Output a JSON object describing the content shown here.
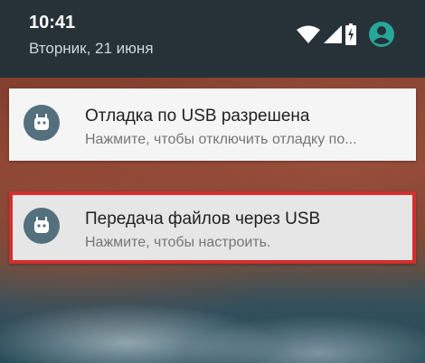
{
  "status_bar": {
    "time": "10:41",
    "date": "Вторник, 21 июня",
    "icons": [
      "wifi-icon",
      "signal-icon",
      "battery-charging-icon",
      "account-icon"
    ]
  },
  "notifications": [
    {
      "app_icon": "android-icon",
      "title": "Отладка по USB разрешена",
      "text": "Нажмите, чтобы отключить отладку по..."
    },
    {
      "app_icon": "android-icon",
      "title": "Передача файлов через USB",
      "text": "Нажмите, чтобы настроить.",
      "highlighted": true
    }
  ],
  "colors": {
    "shade": "#263238",
    "card": "#f5f5f5",
    "app_icon_bg": "#54707e",
    "highlight_border": "#d32f2f",
    "account_icon": "#26a69a"
  }
}
